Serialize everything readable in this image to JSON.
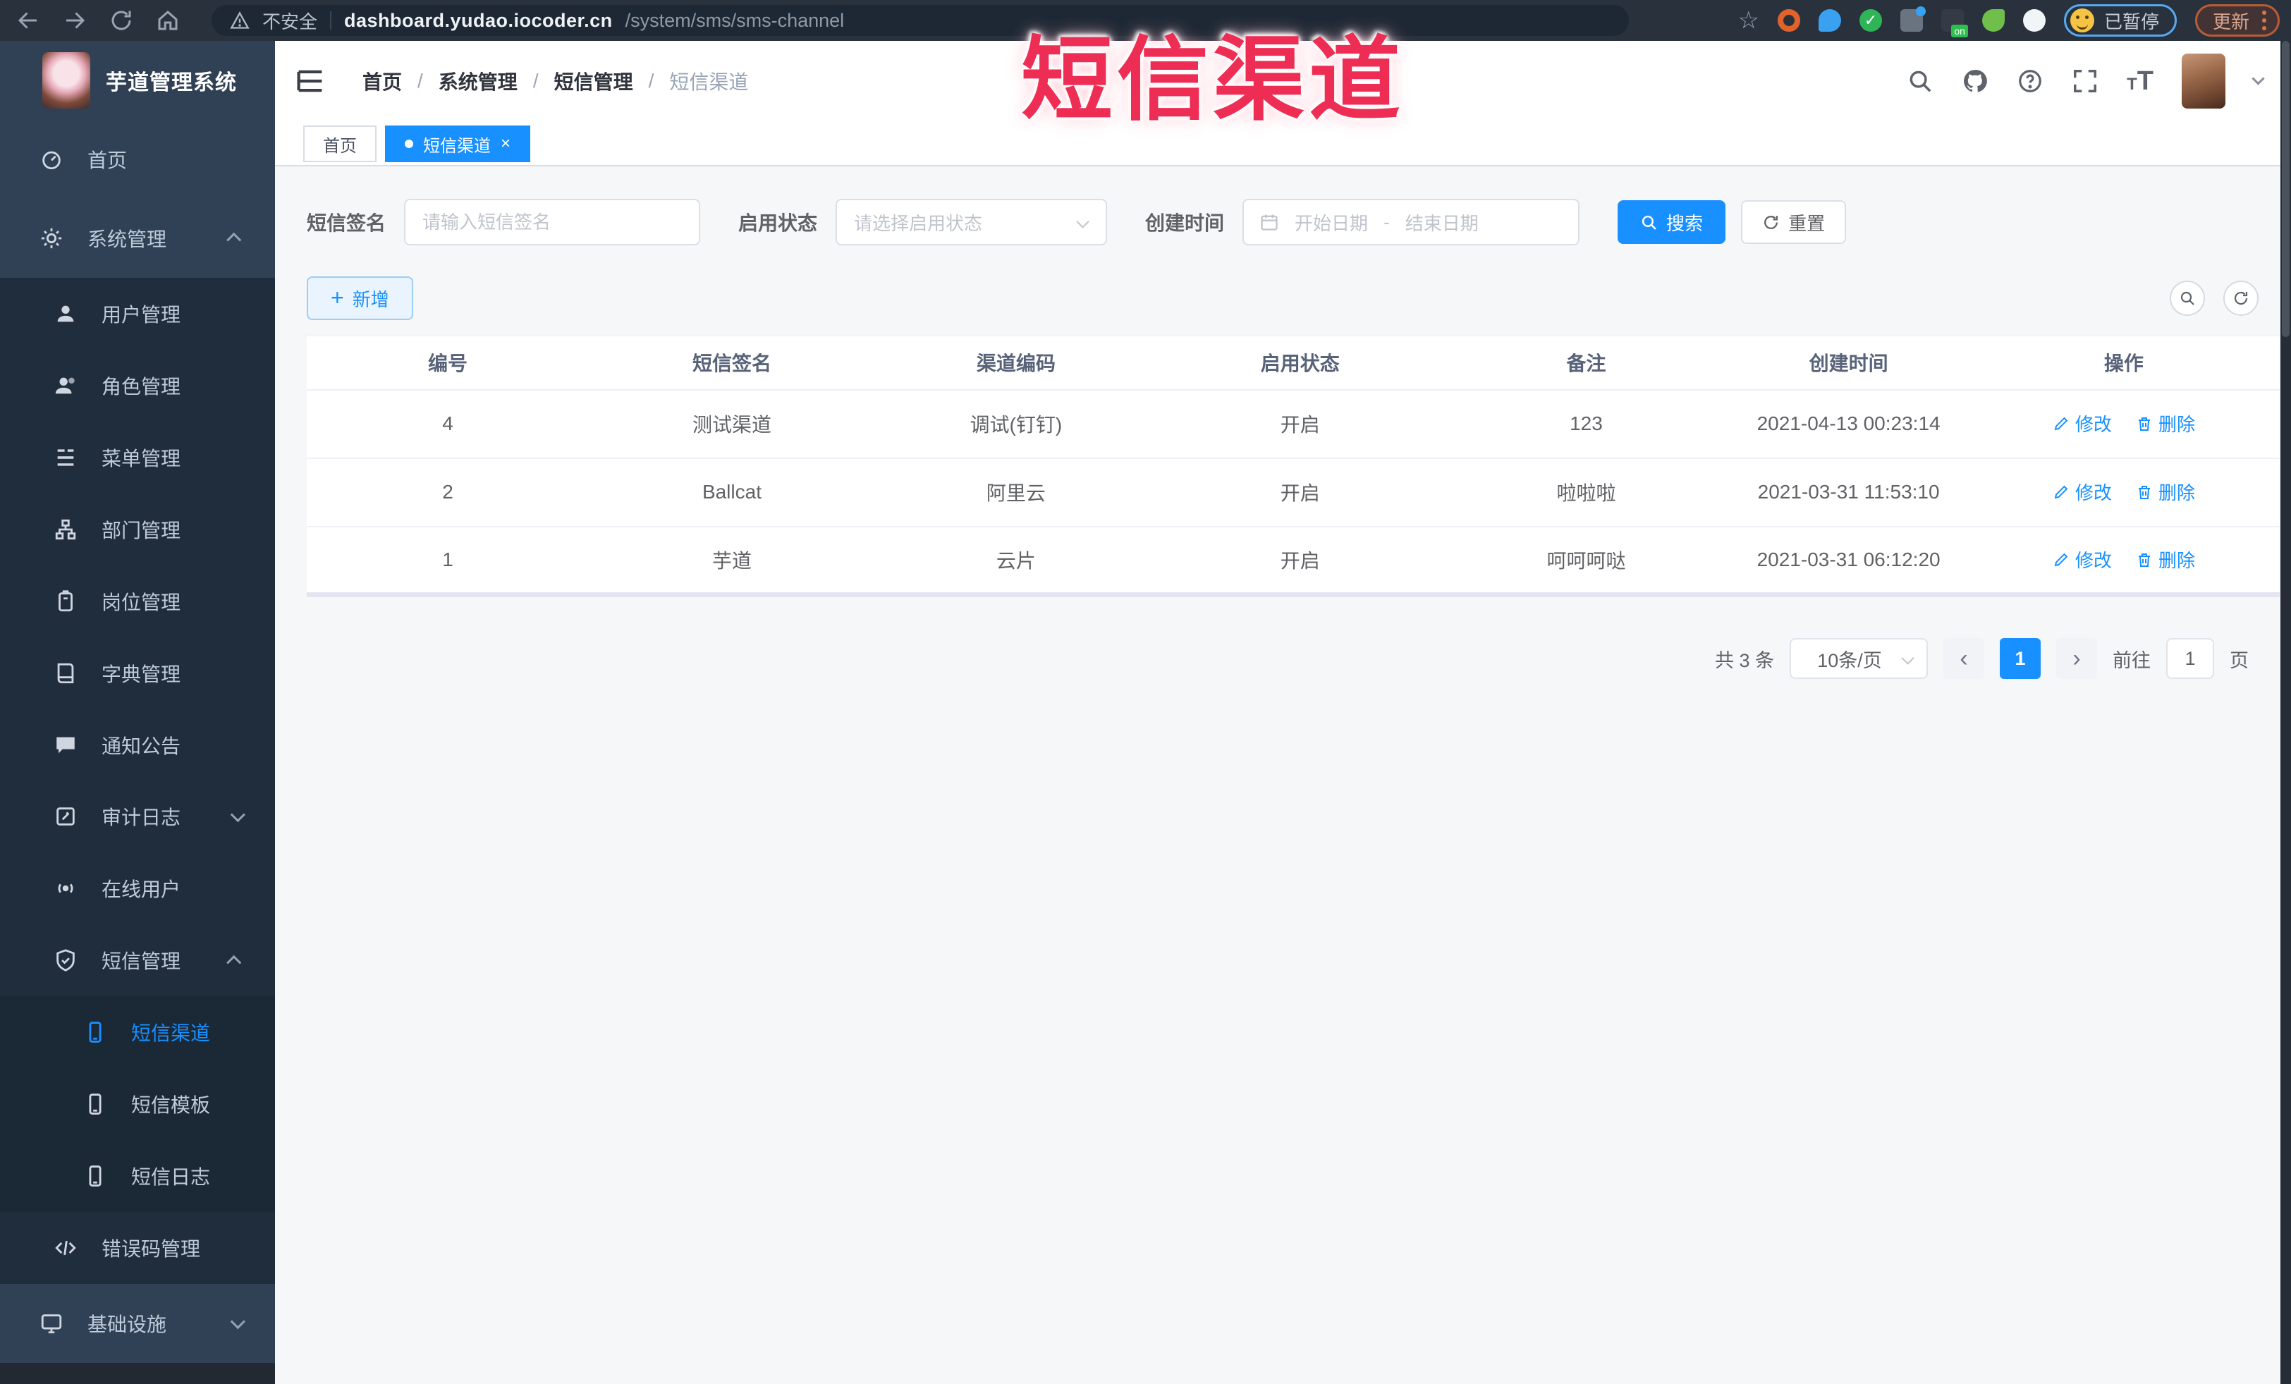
{
  "browser": {
    "security_label": "不安全",
    "url_host": "dashboard.yudao.iocoder.cn",
    "url_path": "/system/sms/sms-channel",
    "paused_label": "已暂停",
    "update_label": "更新"
  },
  "icons": {
    "bookmark_star": "☆",
    "check": "✓",
    "plus": "+",
    "close": "×",
    "prev": "‹",
    "next": "›"
  },
  "overlay": {
    "title": "短信渠道",
    "color": "#ee2d55"
  },
  "sidebar": {
    "app_title": "芋道管理系统",
    "items": [
      {
        "label": "首页"
      },
      {
        "label": "系统管理"
      },
      {
        "label": "用户管理"
      },
      {
        "label": "角色管理"
      },
      {
        "label": "菜单管理"
      },
      {
        "label": "部门管理"
      },
      {
        "label": "岗位管理"
      },
      {
        "label": "字典管理"
      },
      {
        "label": "通知公告"
      },
      {
        "label": "审计日志"
      },
      {
        "label": "在线用户"
      },
      {
        "label": "短信管理"
      },
      {
        "label": "短信渠道",
        "active": true
      },
      {
        "label": "短信模板"
      },
      {
        "label": "短信日志"
      },
      {
        "label": "错误码管理"
      },
      {
        "label": "基础设施"
      }
    ]
  },
  "breadcrumb": {
    "separator": "/",
    "items": [
      "首页",
      "系统管理",
      "短信管理",
      "短信渠道"
    ]
  },
  "tabs": [
    {
      "label": "首页"
    },
    {
      "label": "短信渠道",
      "active": true
    }
  ],
  "filters": {
    "sign_label": "短信签名",
    "sign_placeholder": "请输入短信签名",
    "status_label": "启用状态",
    "status_placeholder": "请选择启用状态",
    "time_label": "创建时间",
    "start_placeholder": "开始日期",
    "range_separator": "-",
    "end_placeholder": "结束日期",
    "search_label": "搜索",
    "reset_label": "重置"
  },
  "toolbar": {
    "add_label": "新增"
  },
  "table": {
    "headers": [
      "编号",
      "短信签名",
      "渠道编码",
      "启用状态",
      "备注",
      "创建时间",
      "操作"
    ],
    "edit_label": "修改",
    "delete_label": "删除",
    "rows": [
      {
        "id": "4",
        "sign": "测试渠道",
        "code": "调试(钉钉)",
        "status": "开启",
        "remark": "123",
        "created": "2021-04-13 00:23:14"
      },
      {
        "id": "2",
        "sign": "Ballcat",
        "code": "阿里云",
        "status": "开启",
        "remark": "啦啦啦",
        "created": "2021-03-31 11:53:10"
      },
      {
        "id": "1",
        "sign": "芋道",
        "code": "云片",
        "status": "开启",
        "remark": "呵呵呵哒",
        "created": "2021-03-31 06:12:20"
      }
    ]
  },
  "pagination": {
    "total": "共 3 条",
    "page_size": "10条/页",
    "current": "1",
    "goto_label": "前往",
    "goto_value": "1",
    "page_label": "页"
  },
  "colors": {
    "accent_blue": "#1890ff",
    "sidebar_bg": "#304156",
    "submenu_bg": "#1f2d3d",
    "overlay_red": "#ee2d55",
    "chrome_bg": "#28313c"
  }
}
